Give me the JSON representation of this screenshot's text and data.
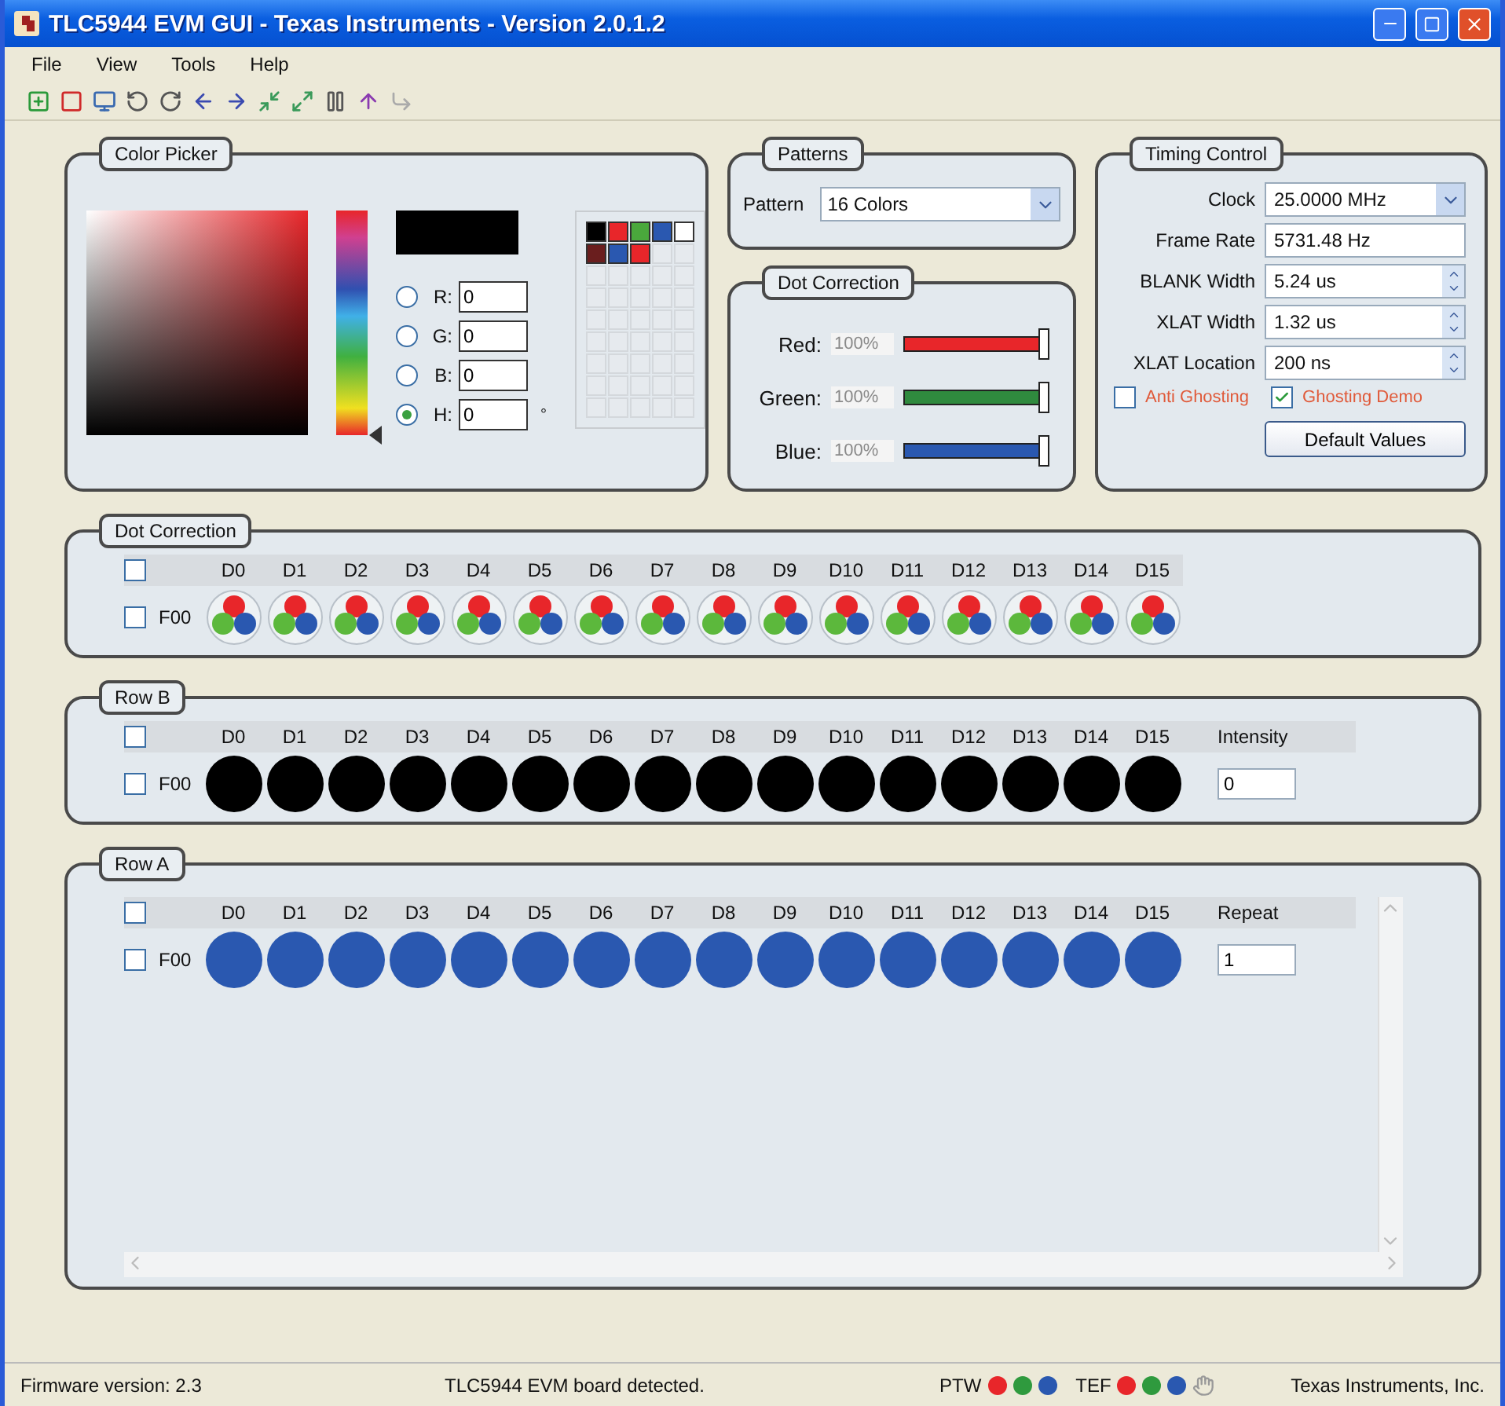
{
  "window": {
    "title": "TLC5944 EVM GUI - Texas Instruments - Version 2.0.1.2"
  },
  "menu": [
    "File",
    "View",
    "Tools",
    "Help"
  ],
  "color_picker": {
    "title": "Color Picker",
    "unit": "°",
    "channels": [
      {
        "label": "R:",
        "value": "0",
        "selected": false
      },
      {
        "label": "G:",
        "value": "0",
        "selected": false
      },
      {
        "label": "B:",
        "value": "0",
        "selected": false
      },
      {
        "label": "H:",
        "value": "0",
        "selected": true
      }
    ],
    "swatches": [
      {
        "color": "#000000"
      },
      {
        "color": "#e8262a"
      },
      {
        "color": "#4aa83c"
      },
      {
        "color": "#2a58b0"
      },
      {
        "color": "#ffffff"
      },
      {
        "color": "#6a1e1e"
      },
      {
        "color": "#2a58b0"
      },
      {
        "color": "#e8262a"
      }
    ]
  },
  "patterns": {
    "title": "Patterns",
    "label": "Pattern",
    "value": "16 Colors"
  },
  "dot_correction": {
    "title": "Dot Correction",
    "channels": [
      {
        "label": "Red:",
        "reading": "100%",
        "disabled": true,
        "level": 1,
        "color": "#e8262a"
      },
      {
        "label": "Green:",
        "reading": "100%",
        "disabled": true,
        "level": 1,
        "color": "#2f8a3e"
      },
      {
        "label": "Blue:",
        "reading": "100%",
        "disabled": true,
        "level": 1,
        "color": "#2a58b0"
      }
    ]
  },
  "timing_control": {
    "title": "Timing Control",
    "fields": [
      {
        "label": "Clock",
        "value": "25.0000 MHz",
        "kind": "dropdown"
      },
      {
        "label": "Frame Rate",
        "value": "5731.48 Hz",
        "kind": "text"
      },
      {
        "label": "BLANK Width",
        "value": "5.24 us",
        "kind": "spinner"
      },
      {
        "label": "XLAT Width",
        "value": "1.32 us",
        "kind": "spinner"
      },
      {
        "label": "XLAT Location",
        "value": "200 ns",
        "kind": "spinner"
      }
    ],
    "checkboxes": [
      {
        "label": "Anti Ghosting",
        "checked": false
      },
      {
        "label": "Ghosting Demo",
        "checked": true
      }
    ],
    "button": "Default Values"
  },
  "dot_panels": [
    {
      "title": "Dot Correction",
      "kind": "rgb",
      "header_checked": false,
      "row_label": "F00",
      "row_checked": false,
      "columns": [
        "D0",
        "D1",
        "D2",
        "D3",
        "D4",
        "D5",
        "D6",
        "D7",
        "D8",
        "D9",
        "D10",
        "D11",
        "D12",
        "D13",
        "D14",
        "D15"
      ]
    },
    {
      "title": "Row B",
      "kind": "solid",
      "header_checked": false,
      "row_label": "F00",
      "row_checked": false,
      "color": "#000000",
      "extra": {
        "label": "Intensity",
        "value": "0"
      },
      "columns": [
        "D0",
        "D1",
        "D2",
        "D3",
        "D4",
        "D5",
        "D6",
        "D7",
        "D8",
        "D9",
        "D10",
        "D11",
        "D12",
        "D13",
        "D14",
        "D15"
      ]
    },
    {
      "title": "Row A",
      "kind": "scroll",
      "header_checked": false,
      "row_label": "F00",
      "row_checked": false,
      "color": "#2a58b0",
      "extra": {
        "label": "Repeat",
        "value": "1"
      },
      "columns": [
        "D0",
        "D1",
        "D2",
        "D3",
        "D4",
        "D5",
        "D6",
        "D7",
        "D8",
        "D9",
        "D10",
        "D11",
        "D12",
        "D13",
        "D14",
        "D15"
      ]
    }
  ],
  "status_bar": {
    "firmware": "Firmware version: 2.3",
    "message": "TLC5944 EVM board detected.",
    "indicators": [
      {
        "label": "PTW",
        "dots": [
          {
            "color": "#e8262a"
          },
          {
            "color": "#2f9a3e"
          },
          {
            "color": "#2a58b0"
          }
        ]
      },
      {
        "label": "TEF",
        "dots": [
          {
            "color": "#e8262a"
          },
          {
            "color": "#2f9a3e"
          },
          {
            "color": "#2a58b0"
          }
        ]
      }
    ],
    "company": "Texas Instruments, Inc."
  }
}
